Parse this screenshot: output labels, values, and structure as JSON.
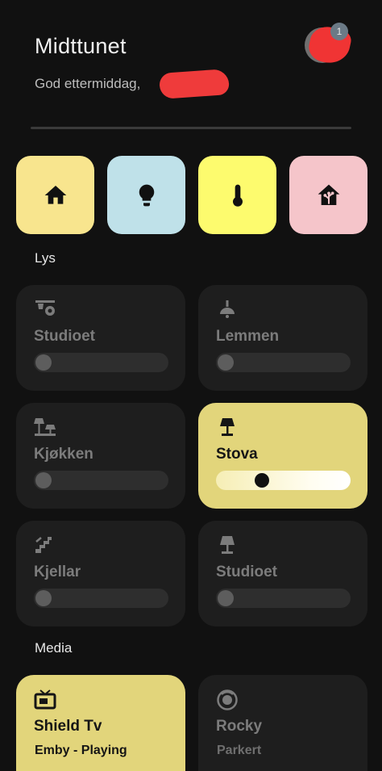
{
  "header": {
    "title": "Midttunet",
    "greeting": "God ettermiddag,",
    "notification_count": "1"
  },
  "nav": [
    {
      "name": "home",
      "icon": "home-icon",
      "color": "#f8e58e"
    },
    {
      "name": "lights",
      "icon": "lightbulb-icon",
      "color": "#bfe1e9"
    },
    {
      "name": "climate",
      "icon": "thermometer-icon",
      "color": "#fdfb6e"
    },
    {
      "name": "automation",
      "icon": "home-assistant-icon",
      "color": "#f5c5ca"
    }
  ],
  "sections": {
    "lights_title": "Lys",
    "media_title": "Media"
  },
  "lights": [
    {
      "label": "Studioet",
      "icon": "spotlight-icon",
      "on": false,
      "brightness": 0
    },
    {
      "label": "Lemmen",
      "icon": "ceiling-lamp-icon",
      "on": false,
      "brightness": 0
    },
    {
      "label": "Kjøkken",
      "icon": "table-lamps-icon",
      "on": false,
      "brightness": 0
    },
    {
      "label": "Stova",
      "icon": "floor-lamp-icon",
      "on": true,
      "brightness": 0.32
    },
    {
      "label": "Kjellar",
      "icon": "stairs-icon",
      "on": false,
      "brightness": 0
    },
    {
      "label": "Studioet",
      "icon": "desk-lamp-icon",
      "on": false,
      "brightness": 0
    }
  ],
  "media": [
    {
      "label": "Shield Tv",
      "status": "Emby - Playing",
      "icon": "tv-icon",
      "on": true
    },
    {
      "label": "Rocky",
      "status": "Parkert",
      "icon": "robot-vacuum-icon",
      "on": false
    }
  ]
}
